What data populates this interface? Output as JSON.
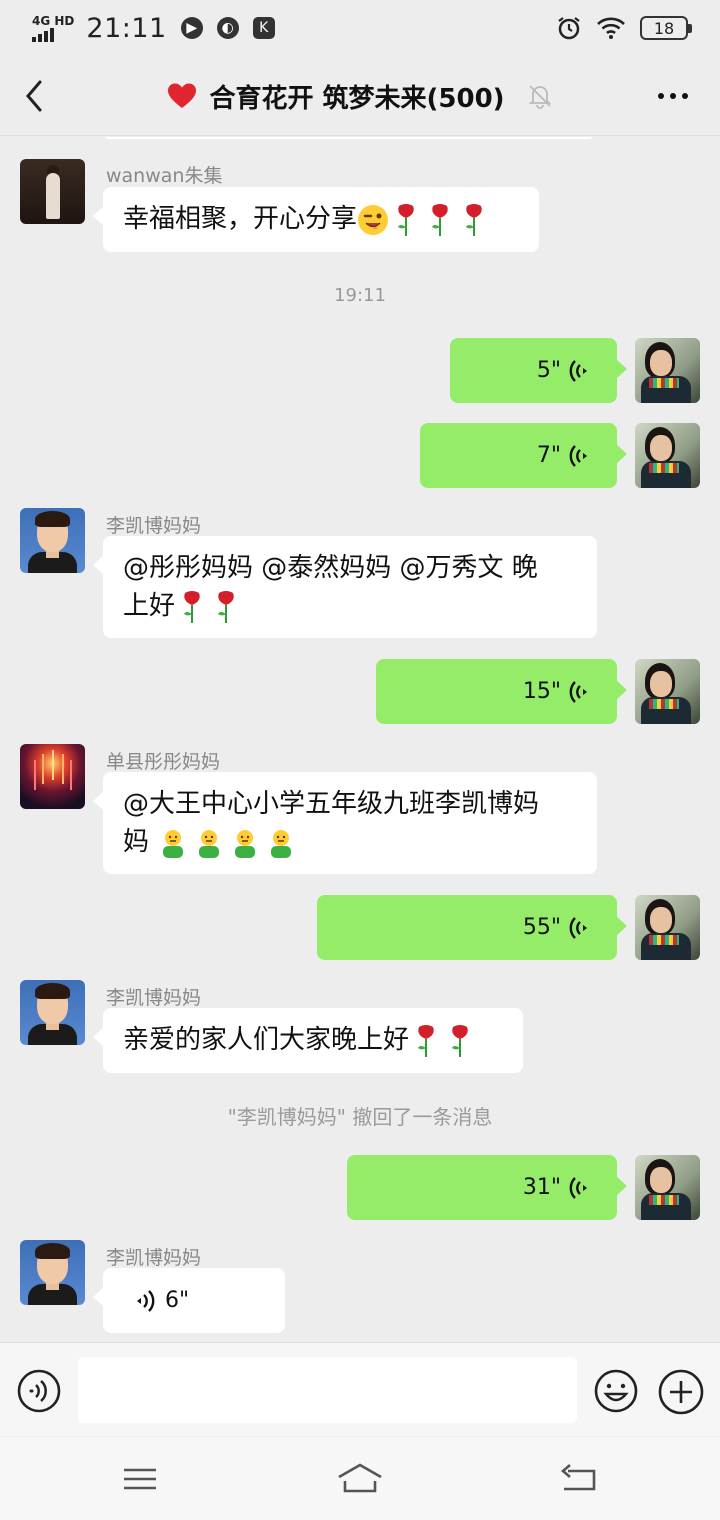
{
  "status_bar": {
    "network": "4G HD",
    "time": "21:11",
    "battery": "18"
  },
  "header": {
    "title": "合育花开 筑梦未来(500)"
  },
  "messages": {
    "m1": {
      "sender": "wanwan朱集",
      "text": "幸福相聚，开心分享"
    },
    "timestamp": "19:11",
    "v1": {
      "duration": "5\""
    },
    "v2": {
      "duration": "7\""
    },
    "m2": {
      "sender": "李凯博妈妈",
      "line1": "@彤彤妈妈 @泰然妈妈 @万秀文  晚",
      "line2": "上好"
    },
    "v3": {
      "duration": "15\""
    },
    "m3": {
      "sender": "单县彤彤妈妈",
      "line1": "@大王中心小学五年级九班李凯博妈",
      "line2": "妈 "
    },
    "v4": {
      "duration": "55\""
    },
    "m4": {
      "sender": "李凯博妈妈",
      "text": "亲爱的家人们大家晚上好"
    },
    "recall": "\"李凯博妈妈\" 撤回了一条消息",
    "v5": {
      "duration": "31\""
    },
    "m5": {
      "sender": "李凯博妈妈",
      "duration": "6\""
    }
  },
  "input": {
    "placeholder": ""
  },
  "colors": {
    "outgoing_bubble": "#95ec69",
    "incoming_bubble": "#ffffff",
    "background": "#ededed"
  },
  "icons": [
    "back-icon",
    "heart-icon",
    "mute-bell-icon",
    "more-icon",
    "voice-wave-icon",
    "rose-icon",
    "wink-emoji-icon",
    "green-person-emoji-icon",
    "voice-input-icon",
    "emoji-icon",
    "plus-icon",
    "menu-icon",
    "home-icon",
    "back-nav-icon"
  ]
}
